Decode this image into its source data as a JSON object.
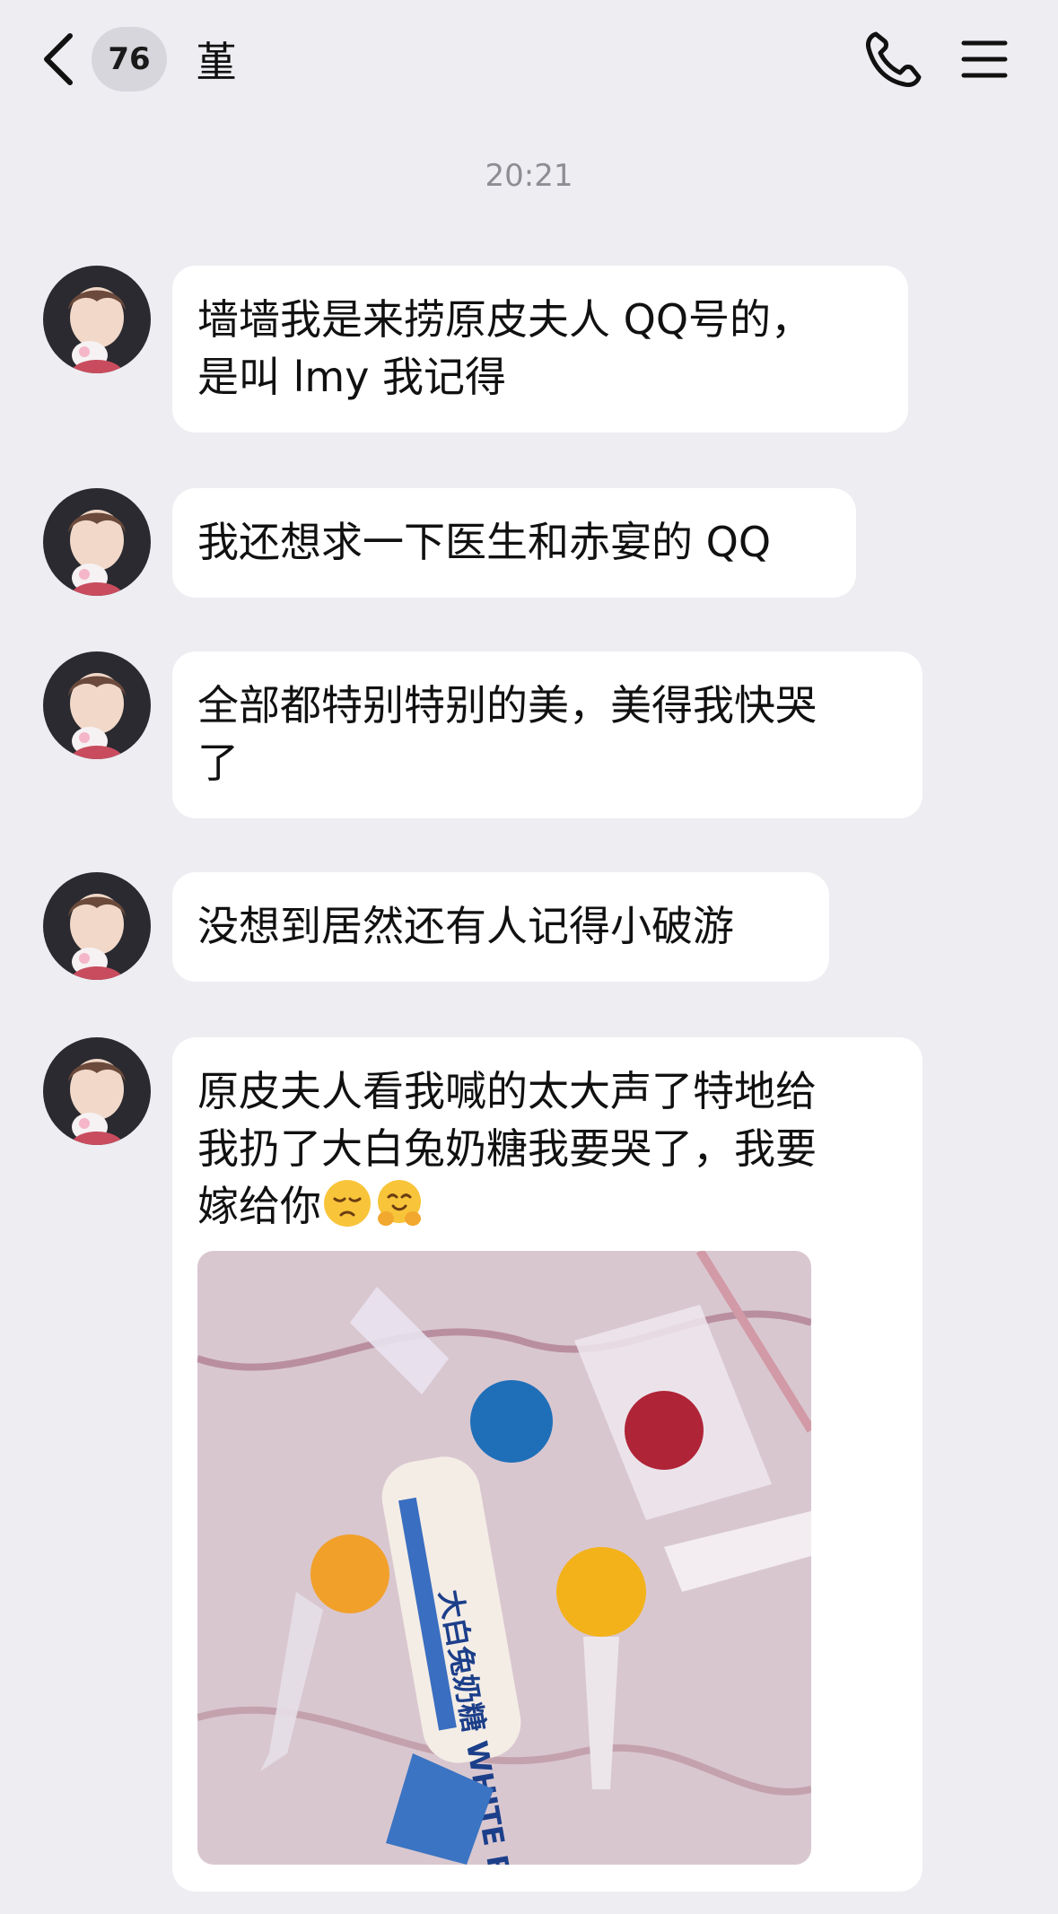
{
  "header": {
    "unread_count": "76",
    "contact_name": "堇"
  },
  "timestamp": "20:21",
  "messages": [
    {
      "text": "墙墙我是来捞原皮夫人 QQ号的，\n是叫 lmy 我记得"
    },
    {
      "text": "我还想求一下医生和赤宴的 QQ"
    },
    {
      "text": "全部都特别特别的美，美得我快哭\n了"
    },
    {
      "text": "没想到居然还有人记得小破游"
    },
    {
      "text": "原皮夫人看我喊的太大声了特地给\n我扔了大白兔奶糖我要哭了，我要\n嫁给你"
    }
  ],
  "emojis": [
    "pensive-face-emoji",
    "hugging-face-emoji"
  ],
  "photo_caption_text": "大白兔奶糖 WHITE RABBIT",
  "colors": {
    "background": "#ededf2",
    "bubble": "#ffffff",
    "badge": "#d6d6dc",
    "timestamp": "#8d8d93"
  }
}
